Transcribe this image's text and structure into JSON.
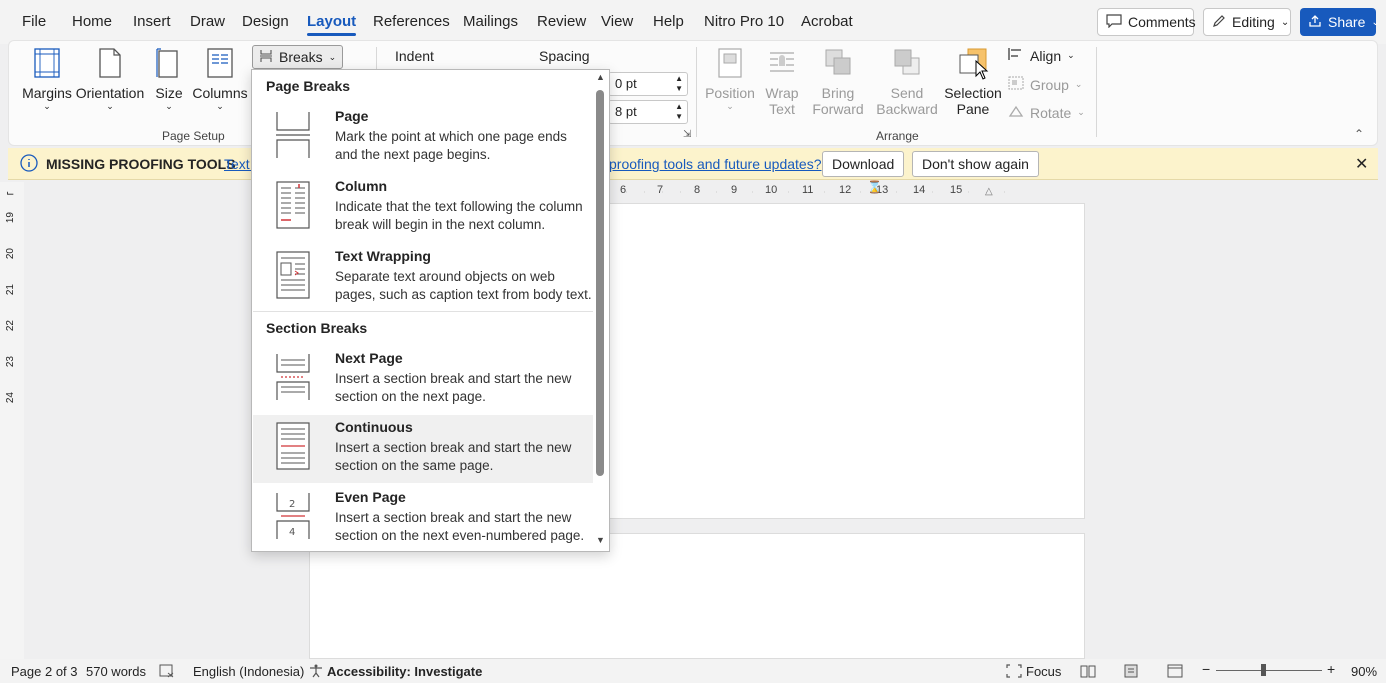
{
  "menu": {
    "tabs": [
      "File",
      "Home",
      "Insert",
      "Draw",
      "Design",
      "Layout",
      "References",
      "Mailings",
      "Review",
      "View",
      "Help",
      "Nitro Pro 10",
      "Acrobat"
    ],
    "comments": "Comments",
    "editing": "Editing",
    "share": "Share"
  },
  "ribbon": {
    "margins": "Margins",
    "orientation": "Orientation",
    "size": "Size",
    "columns": "Columns",
    "breaks": "Breaks",
    "page_setup": "Page Setup",
    "indent": "Indent",
    "spacing": "Spacing",
    "spacing_before": "0 pt",
    "spacing_after": "8 pt",
    "position": "Position",
    "wrap_text_1": "Wrap",
    "wrap_text_2": "Text",
    "bring_forward_1": "Bring",
    "bring_forward_2": "Forward",
    "send_backward_1": "Send",
    "send_backward_2": "Backward",
    "selection_pane_1": "Selection",
    "selection_pane_2": "Pane",
    "align": "Align",
    "group": "Group",
    "rotate": "Rotate",
    "arrange": "Arrange"
  },
  "notification": {
    "title": "MISSING PROOFING TOOLS",
    "text_start": "Text l",
    "link": "proofing tools and future updates?",
    "download": "Download",
    "dont_show": "Don't show again"
  },
  "breaks_menu": {
    "page_breaks": "Page Breaks",
    "section_breaks": "Section Breaks",
    "items": [
      {
        "title": "Page",
        "desc": "Mark the point at which one page ends and the next page begins."
      },
      {
        "title": "Column",
        "desc": "Indicate that the text following the column break will begin in the next column."
      },
      {
        "title": "Text Wrapping",
        "desc": "Separate text around objects on web pages, such as caption text from body text."
      },
      {
        "title": "Next Page",
        "desc": "Insert a section break and start the new section on the next page."
      },
      {
        "title": "Continuous",
        "desc": "Insert a section break and start the new section on the same page."
      },
      {
        "title": "Even Page",
        "desc": "Insert a section break and start the new section on the next even-numbered page."
      }
    ]
  },
  "ruler": {
    "h_ticks": [
      "6",
      "7",
      "8",
      "9",
      "10",
      "11",
      "12",
      "13",
      "14",
      "15"
    ],
    "v_ticks": [
      "19",
      "20",
      "21",
      "22",
      "23",
      "24"
    ]
  },
  "status": {
    "page": "Page 2 of 3",
    "words": "570 words",
    "language": "English (Indonesia)",
    "accessibility": "Accessibility: Investigate",
    "focus": "Focus",
    "zoom": "90%"
  },
  "colors": {
    "accent": "#185abd",
    "notification": "#fcf3cc"
  }
}
